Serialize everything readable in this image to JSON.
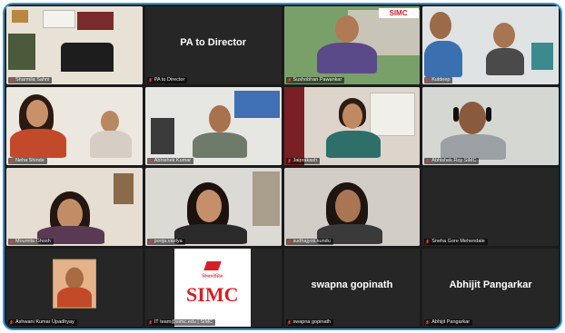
{
  "tiles": [
    {
      "name": "Sharmila Sahni",
      "big_text": ""
    },
    {
      "name": "PA to Director",
      "big_text": "PA to Director"
    },
    {
      "name": "Sushobhan Pawankar",
      "big_text": "",
      "logo_text": "SIMC"
    },
    {
      "name": "Kuldeep",
      "big_text": ""
    },
    {
      "name": "Neha Shinde",
      "big_text": ""
    },
    {
      "name": "Abhishek Kumar",
      "big_text": ""
    },
    {
      "name": "Jaiprakash",
      "big_text": ""
    },
    {
      "name": "Abhishek Roy SIMC",
      "big_text": ""
    },
    {
      "name": "Moumita Ghosh",
      "big_text": ""
    },
    {
      "name": "pooja.vaidya",
      "big_text": ""
    },
    {
      "name": "sudhajyoti.kundu",
      "big_text": ""
    },
    {
      "name": "Sneha Gore Mehendale",
      "big_text": ""
    },
    {
      "name": "Ashwani Kumar Upadhyay",
      "big_text": ""
    },
    {
      "name": "IT team@simc.edu | SIMC",
      "big_text": "",
      "logo_text": "SIMC",
      "logo_subtext": "सिम्बायोसिस"
    },
    {
      "name": "swapna gopinath",
      "big_text": "swapna gopinath"
    },
    {
      "name": "Abhijit Pangarkar",
      "big_text": "Abhijit Pangarkar"
    }
  ],
  "colors": {
    "accent_border": "#2e9bd6",
    "active_speaker": "#c9e24b",
    "simc_red": "#d32027",
    "muted_mic": "#e23b3b"
  }
}
